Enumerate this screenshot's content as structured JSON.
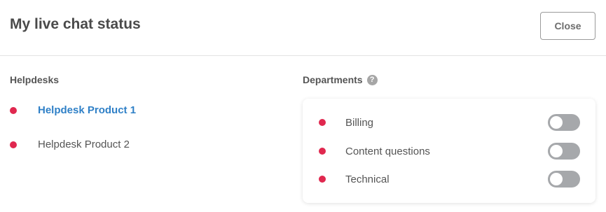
{
  "header": {
    "title": "My live chat status",
    "close_label": "Close"
  },
  "helpdesks": {
    "label": "Helpdesks",
    "items": [
      {
        "label": "Helpdesk Product 1",
        "active": true,
        "status_color": "#e0284f"
      },
      {
        "label": "Helpdesk Product 2",
        "active": false,
        "status_color": "#e0284f"
      }
    ]
  },
  "departments": {
    "label": "Departments",
    "help_icon": "?",
    "items": [
      {
        "label": "Billing",
        "enabled": false,
        "status_color": "#e0284f"
      },
      {
        "label": "Content questions",
        "enabled": false,
        "status_color": "#e0284f"
      },
      {
        "label": "Technical",
        "enabled": false,
        "status_color": "#e0284f"
      }
    ]
  },
  "colors": {
    "accent": "#2f80c7",
    "status_offline": "#e0284f",
    "toggle_off": "#a6a8ab"
  }
}
